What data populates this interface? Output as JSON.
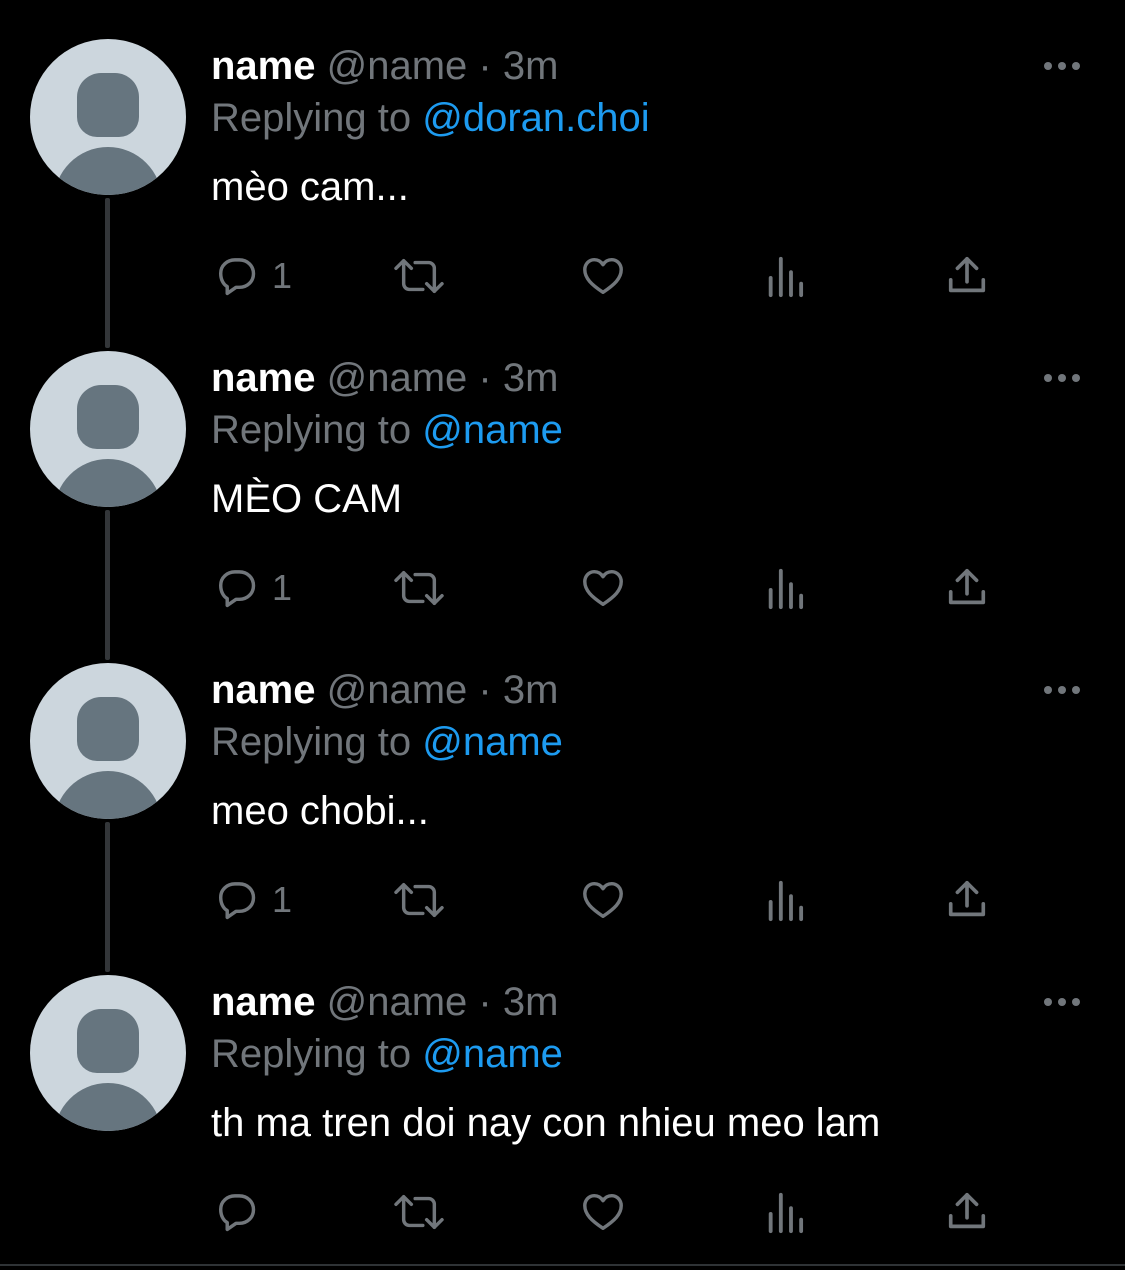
{
  "colors": {
    "background": "#000000",
    "text_primary": "#ffffff",
    "text_secondary": "#71767b",
    "link": "#1d9bf0",
    "thread_line": "#333639",
    "avatar_bg": "#ccd6dd",
    "avatar_fg": "#66757f"
  },
  "tweets": [
    {
      "display_name": "name",
      "handle": "@name",
      "separator": "·",
      "time": "3m",
      "replying_prefix": "Replying to",
      "replying_to": "@doran.choi",
      "text": "mèo cam...",
      "reply_count": "1",
      "more_icon": "more-horizontal-icon",
      "avatar_icon": "default-avatar-icon"
    },
    {
      "display_name": "name",
      "handle": "@name",
      "separator": "·",
      "time": "3m",
      "replying_prefix": "Replying to",
      "replying_to": "@name",
      "text": "MÈO CAM",
      "reply_count": "1",
      "more_icon": "more-horizontal-icon",
      "avatar_icon": "default-avatar-icon"
    },
    {
      "display_name": "name",
      "handle": "@name",
      "separator": "·",
      "time": "3m",
      "replying_prefix": "Replying to",
      "replying_to": "@name",
      "text": "meo chobi...",
      "reply_count": "1",
      "more_icon": "more-horizontal-icon",
      "avatar_icon": "default-avatar-icon"
    },
    {
      "display_name": "name",
      "handle": "@name",
      "separator": "·",
      "time": "3m",
      "replying_prefix": "Replying to",
      "replying_to": "@name",
      "text": "th ma tren doi nay con nhieu meo lam",
      "reply_count": "",
      "more_icon": "more-horizontal-icon",
      "avatar_icon": "default-avatar-icon"
    }
  ],
  "action_icons": [
    "reply-icon",
    "retweet-icon",
    "like-icon",
    "views-icon",
    "share-icon"
  ]
}
